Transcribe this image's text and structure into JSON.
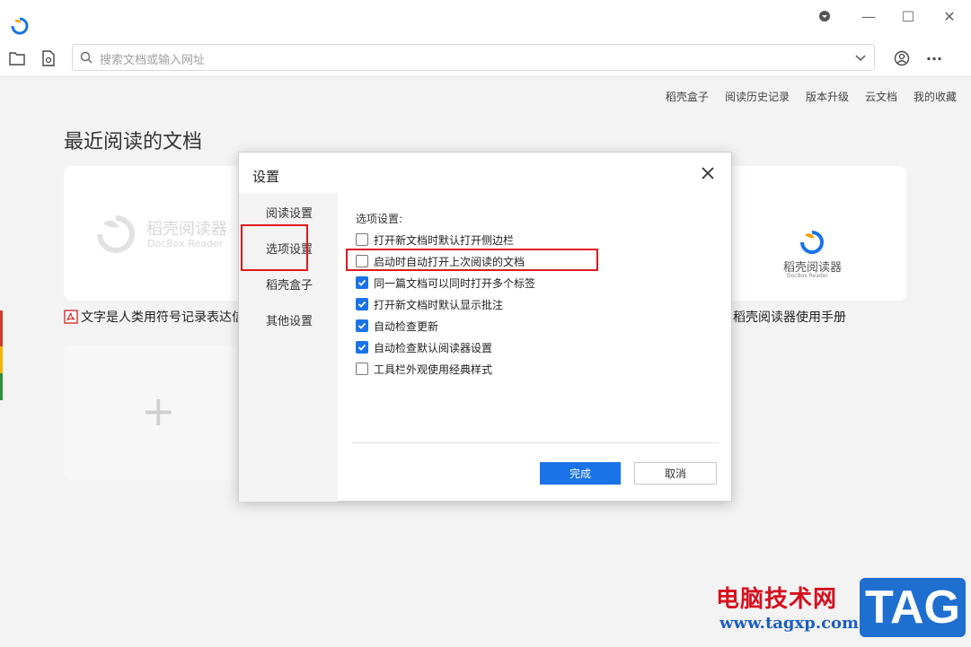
{
  "window": {
    "minimize_glyph": "—",
    "maximize_glyph": "☐",
    "close_glyph": "✕"
  },
  "toolbar": {
    "search_placeholder": "搜索文档或输入网址",
    "more_glyph": "···"
  },
  "nav_links": [
    "稻壳盒子",
    "阅读历史记录",
    "版本升级",
    "云文档",
    "我的收藏"
  ],
  "recent": {
    "title": "最近阅读的文档",
    "cards": [
      {
        "logo_cn": "稻壳阅读器",
        "logo_en": "DocBox Reader",
        "label": "文字是人类用符号记录表达信"
      },
      {
        "logo_cn": "稻壳阅读器",
        "logo_en": "DocBox Reader",
        "label": "稻壳阅读器使用手册"
      }
    ],
    "add_glyph": "+"
  },
  "dialog": {
    "title": "设置",
    "sidebar": [
      "阅读设置",
      "选项设置",
      "稻壳盒子",
      "其他设置"
    ],
    "section_title": "选项设置:",
    "options": [
      {
        "label": "打开新文档时默认打开侧边栏",
        "checked": false
      },
      {
        "label": "启动时自动打开上次阅读的文档",
        "checked": false
      },
      {
        "label": "同一篇文档可以同时打开多个标签",
        "checked": true
      },
      {
        "label": "打开新文档时默认显示批注",
        "checked": true
      },
      {
        "label": "自动检查更新",
        "checked": true
      },
      {
        "label": "自动检查默认阅读器设置",
        "checked": true
      },
      {
        "label": "工具栏外观使用经典样式",
        "checked": false
      }
    ],
    "ok_label": "完成",
    "cancel_label": "取消"
  },
  "watermark": {
    "text": "电脑技术网",
    "url": "www.tagxp.com",
    "tag": "TAG"
  },
  "colors": {
    "accent": "#1a73e8",
    "highlight": "#e0191f",
    "watermark_red": "#d6101e",
    "watermark_blue": "#1f6fd1"
  }
}
